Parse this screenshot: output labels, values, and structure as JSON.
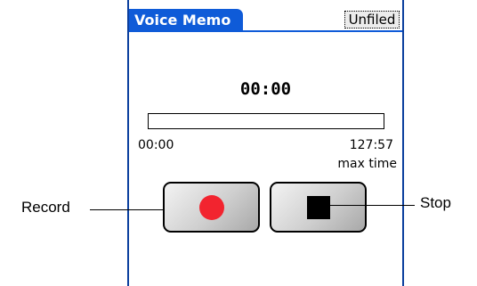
{
  "app": {
    "title": "Voice Memo",
    "category": "Unfiled"
  },
  "recorder": {
    "elapsed": "00:00",
    "start_time": "00:00",
    "end_time": "127:57",
    "max_label": "max time",
    "progress": 0
  },
  "controls": {
    "record_icon": "record-dot-icon",
    "stop_icon": "stop-square-icon"
  },
  "callouts": {
    "record": "Record",
    "stop": "Stop"
  },
  "colors": {
    "title_bar": "#0f5bd8",
    "record": "#f2242f"
  }
}
